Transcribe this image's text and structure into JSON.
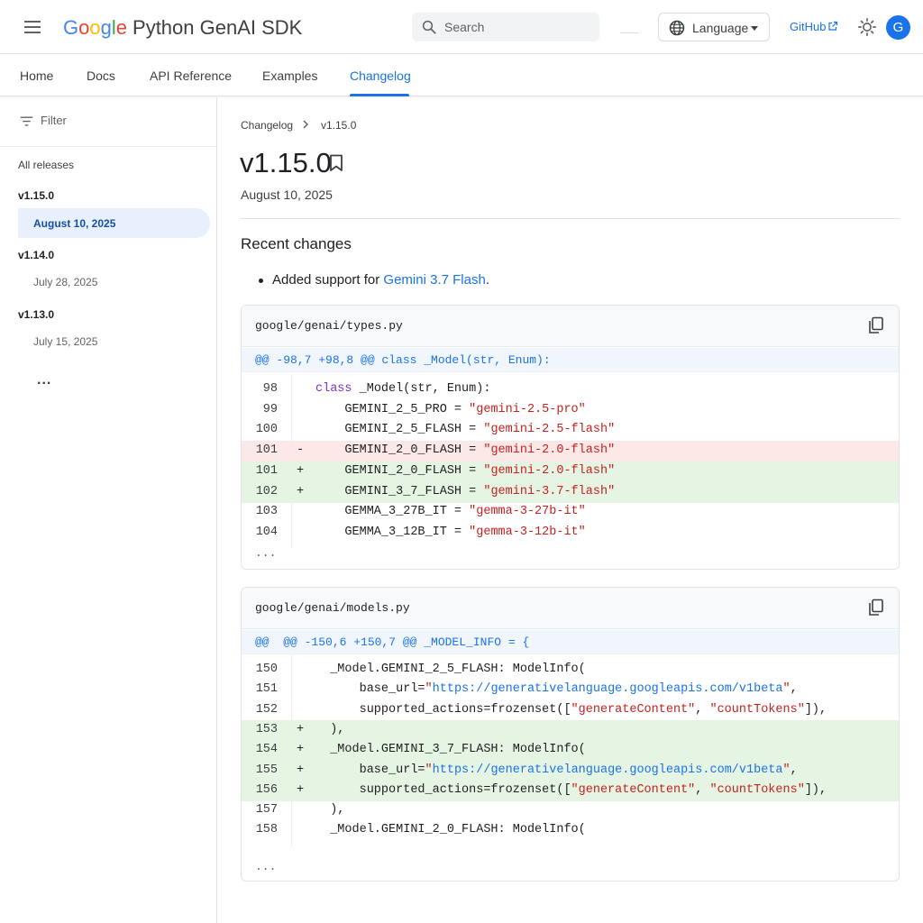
{
  "header": {
    "logo_letters": [
      "G",
      "o",
      "o",
      "g",
      "l",
      "e"
    ],
    "logo_colors": [
      "#4285F4",
      "#EA4335",
      "#FBBC05",
      "#4285F4",
      "#34A853",
      "#EA4335"
    ],
    "product_name": "Python GenAI SDK",
    "search_placeholder": "Search",
    "language_label": "Language",
    "github_label": "GitHub",
    "avatar_initial": "G",
    "icons": [
      "menu-icon",
      "search-icon",
      "globe-icon",
      "external-link-icon",
      "sun-icon"
    ]
  },
  "tabs": [
    {
      "label": "Home"
    },
    {
      "label": "Docs"
    },
    {
      "label": "API Reference"
    },
    {
      "label": "Examples"
    },
    {
      "label": "Changelog",
      "active": true
    }
  ],
  "sidebar": {
    "filter_label": "Filter",
    "all_releases": "All releases",
    "releases": [
      {
        "version": "v1.15.0",
        "date": "August 10, 2025",
        "active": true
      },
      {
        "version": "v1.14.0",
        "date": "July 28, 2025"
      },
      {
        "version": "v1.13.0",
        "date": "July 15, 2025"
      }
    ],
    "more": "..."
  },
  "main": {
    "breadcrumb": {
      "parent": "Changelog",
      "separator": "›",
      "current": "v1.15.0"
    },
    "title": "v1.15.0",
    "date": "August 10, 2025",
    "section_heading": "Recent changes",
    "change": {
      "prefix": "Added support for ",
      "link": "Gemini 3.7 Flash",
      "suffix": "."
    }
  },
  "diffs": [
    {
      "file": "google/genai/types.py",
      "hunk": "@@ -98,7 +98,8 @@ class _Model(str, Enum):",
      "lines": [
        {
          "num": "98",
          "marker": "",
          "type": "ctx",
          "text": "class _Model(str, Enum):"
        },
        {
          "num": "99",
          "marker": "",
          "type": "ctx",
          "text": "    GEMINI_2_5_PRO = \"gemini-2.5-pro\""
        },
        {
          "num": "100",
          "marker": "",
          "type": "ctx",
          "text": "    GEMINI_2_5_FLASH = \"gemini-2.5-flash\""
        },
        {
          "num": "101",
          "marker": "-",
          "type": "del",
          "text": "    GEMINI_2_0_FLASH = \"gemini-2.0-flash\""
        },
        {
          "num": "101",
          "marker": "+",
          "type": "add",
          "text": "    GEMINI_2_0_FLASH = \"gemini-2.0-flash\""
        },
        {
          "num": "102",
          "marker": "+",
          "type": "add",
          "text": "    GEMINI_3_7_FLASH = \"gemini-3.7-flash\""
        },
        {
          "num": "103",
          "marker": "",
          "type": "ctx",
          "text": "    GEMMA_3_27B_IT = \"gemma-3-27b-it\""
        },
        {
          "num": "104",
          "marker": "",
          "type": "ctx",
          "text": "    GEMMA_3_12B_IT = \"gemma-3-12b-it\""
        }
      ],
      "more": "..."
    },
    {
      "file": "google/genai/models.py",
      "hunk": "@@  @@ -150,6 +150,7 @@ _MODEL_INFO = {",
      "lines": [
        {
          "num": "150",
          "marker": "",
          "type": "ctx",
          "text": "  _Model.GEMINI_2_5_FLASH: ModelInfo("
        },
        {
          "num": "151",
          "marker": "",
          "type": "ctx",
          "text": "      base_url=\"https://generativelanguage.googleapis.com/v1beta\","
        },
        {
          "num": "152",
          "marker": "",
          "type": "ctx",
          "text": "      supported_actions=frozenset([\"generateContent\", \"countTokens\"]),"
        },
        {
          "num": "153",
          "marker": "+",
          "type": "add",
          "text": "  ),"
        },
        {
          "num": "154",
          "marker": "+",
          "type": "add",
          "text": "  _Model.GEMINI_3_7_FLASH: ModelInfo("
        },
        {
          "num": "155",
          "marker": "+",
          "type": "add",
          "text": "      base_url=\"https://generativelanguage.googleapis.com/v1beta\","
        },
        {
          "num": "156",
          "marker": "+",
          "type": "add",
          "text": "      supported_actions=frozenset([\"generateContent\", \"countTokens\"]),"
        },
        {
          "num": "157",
          "marker": "",
          "type": "ctx",
          "text": "  ),"
        },
        {
          "num": "158",
          "marker": "",
          "type": "ctx",
          "text": "  _Model.GEMINI_2_0_FLASH: ModelInfo("
        }
      ],
      "more": "..."
    }
  ],
  "colors": {
    "accent": "#1a73e8",
    "added_bg": "#e6f4e3",
    "removed_bg": "#fde8e8",
    "string": "#c5221f",
    "keyword": "#8430ce"
  }
}
